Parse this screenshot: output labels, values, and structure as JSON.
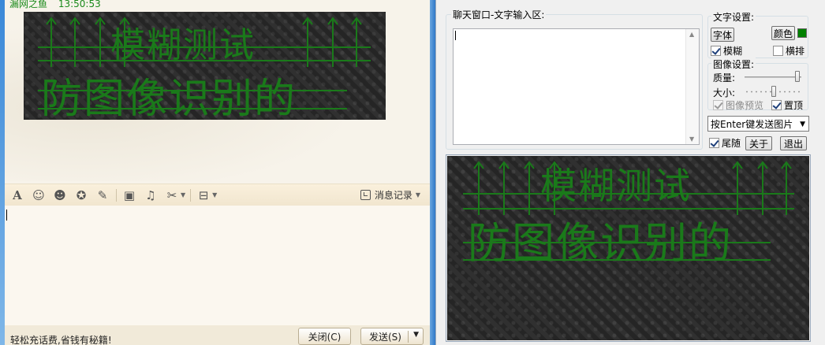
{
  "chat": {
    "header": {
      "contact": "漏网之鱼",
      "time": "13:50:53"
    },
    "image_text": {
      "line1": "模糊测试",
      "line2": "防图像识别的"
    },
    "toolbar": {
      "icons": [
        "font-icon",
        "emoji-icon",
        "avatar-icon",
        "magic-face-icon",
        "edit-icon",
        "image-icon",
        "music-icon",
        "screenshot-icon",
        "app-box-icon"
      ],
      "history_label": "消息记录"
    },
    "input_value": "",
    "promo_text": "轻松充话费,省钱有秘籍!",
    "close_label": "关闭(C)",
    "send_label": "发送(S)"
  },
  "tool": {
    "chat_group_title": "聊天窗口-文字输入区:",
    "chat_input_value": "",
    "text_settings": {
      "title": "文字设置:",
      "font_button": "字体",
      "color_button": "颜色",
      "color_value": "#008000",
      "blur_label": "模糊",
      "blur_checked": true,
      "horizontal_label": "横排",
      "horizontal_checked": false
    },
    "image_settings": {
      "title": "图像设置:",
      "quality_label": "质量:",
      "quality_value": 1.0,
      "size_label": "大小:",
      "size_value": 0.5,
      "preview_label": "图像预览",
      "preview_checked": true,
      "preview_enabled": false,
      "top_label": "置顶",
      "top_checked": true
    },
    "send_mode_select": "按Enter键发送图片",
    "follow_label": "尾随",
    "follow_checked": true,
    "about_button": "关于",
    "exit_button": "退出",
    "image_text": {
      "line1": "模糊测试",
      "line2": "防图像识别的"
    }
  }
}
